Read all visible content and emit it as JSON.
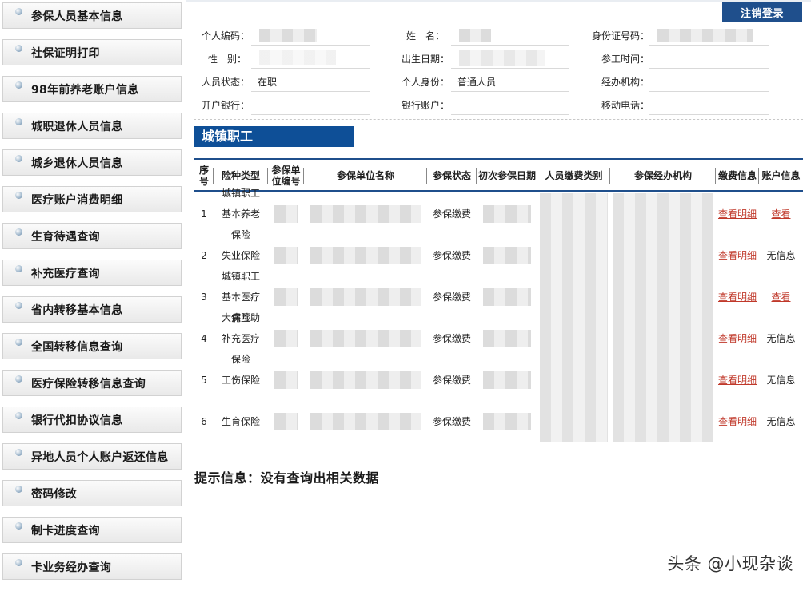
{
  "sidebar": {
    "items": [
      {
        "label": "参保人员基本信息"
      },
      {
        "label": "社保证明打印"
      },
      {
        "label": "98年前养老账户信息"
      },
      {
        "label": "城职退休人员信息"
      },
      {
        "label": "城乡退休人员信息"
      },
      {
        "label": "医疗账户消费明细"
      },
      {
        "label": "生育待遇查询"
      },
      {
        "label": "补充医疗查询"
      },
      {
        "label": "省内转移基本信息"
      },
      {
        "label": "全国转移信息查询"
      },
      {
        "label": "医疗保险转移信息查询"
      },
      {
        "label": "银行代扣协议信息"
      },
      {
        "label": "异地人员个人账户返还信息"
      },
      {
        "label": "密码修改"
      },
      {
        "label": "制卡进度查询"
      },
      {
        "label": "卡业务经办查询"
      }
    ]
  },
  "header": {
    "logout_label": "注销登录"
  },
  "profile": {
    "personal_id_label": "个人编码：",
    "name_label": "姓　名：",
    "id_card_label": "身份证号码：",
    "gender_label": "性　别：",
    "birth_label": "出生日期：",
    "work_start_label": "参工时间：",
    "status_label": "人员状态：",
    "status_value": "在职",
    "identity_label": "个人身份：",
    "identity_value": "普通人员",
    "agency_label": "经办机构：",
    "bank_label": "开户银行：",
    "account_label": "银行账户：",
    "mobile_label": "移动电话："
  },
  "section": {
    "title": "城镇职工"
  },
  "table": {
    "headers": {
      "seq": "序号",
      "type": "险种类型",
      "unit_no": "参保单位编号",
      "unit_name": "参保单位名称",
      "status": "参保状态",
      "first_date": "初次参保日期",
      "pay_category": "人员缴费类别",
      "agency": "参保经办机构",
      "pay_info": "缴费信息",
      "account_info": "账户信息"
    },
    "rows": [
      {
        "seq": "1",
        "type": "城镇职工基本养老保险",
        "status": "参保缴费",
        "pay_info": "查看明细",
        "account_info": "查看",
        "account_is_link": true
      },
      {
        "seq": "2",
        "type": "失业保险",
        "status": "参保缴费",
        "pay_info": "查看明细",
        "account_info": "无信息",
        "account_is_link": false
      },
      {
        "seq": "3",
        "type": "城镇职工基本医疗保险",
        "status": "参保缴费",
        "pay_info": "查看明细",
        "account_info": "查看",
        "account_is_link": true
      },
      {
        "seq": "4",
        "type": "大病互助补充医疗保险",
        "status": "参保缴费",
        "pay_info": "查看明细",
        "account_info": "无信息",
        "account_is_link": false
      },
      {
        "seq": "5",
        "type": "工伤保险",
        "status": "参保缴费",
        "pay_info": "查看明细",
        "account_info": "无信息",
        "account_is_link": false
      },
      {
        "seq": "6",
        "type": "生育保险",
        "status": "参保缴费",
        "pay_info": "查看明细",
        "account_info": "无信息",
        "account_is_link": false
      }
    ]
  },
  "tip": {
    "text": "提示信息：没有查询出相关数据"
  },
  "watermark": {
    "text": "头条 @小现杂谈"
  },
  "colors": {
    "accent": "#1f4f8c",
    "section_bg": "#0e4f97",
    "link": "#c0392b"
  }
}
